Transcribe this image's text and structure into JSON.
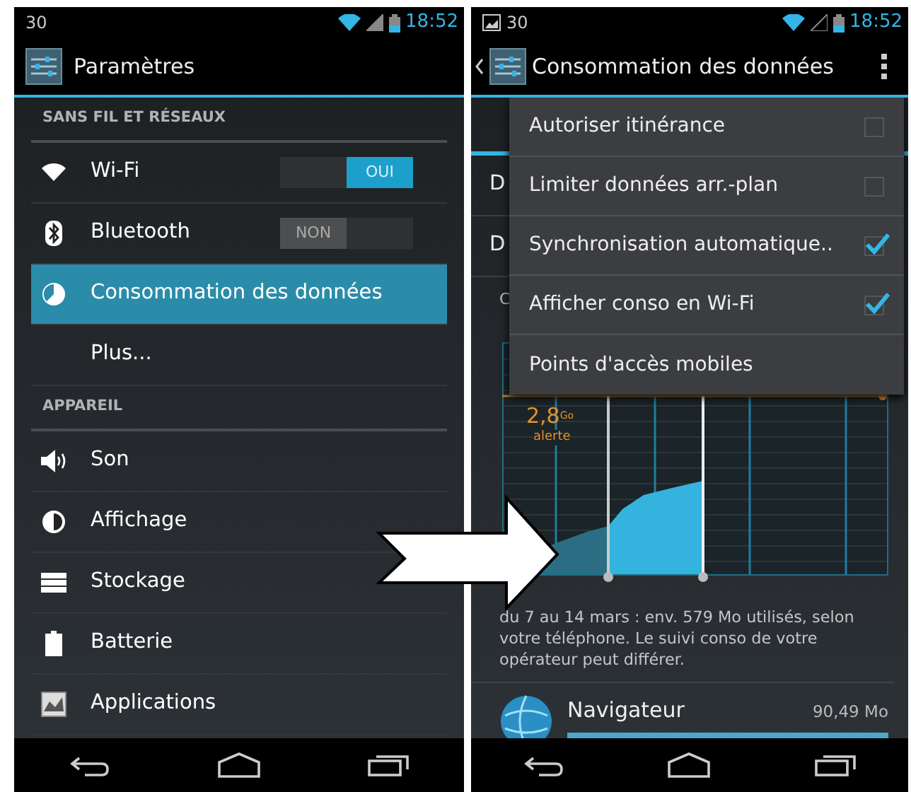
{
  "left_phone": {
    "status_bar": {
      "notification": "30",
      "time": "18:52"
    },
    "title": "Paramètres",
    "sections": [
      {
        "header": "SANS FIL ET RÉSEAUX",
        "items": [
          {
            "label": "Wi-Fi",
            "selected": false,
            "toggle": {
              "label": "OUI",
              "on": true
            }
          },
          {
            "label": "Bluetooth",
            "selected": false,
            "toggle": {
              "label": "NON",
              "on": false
            }
          },
          {
            "label": "Consommation des données",
            "selected": true
          },
          {
            "label": "Plus...",
            "selected": false
          }
        ]
      },
      {
        "header": "APPAREIL",
        "items": [
          {
            "label": "Son",
            "selected": false
          },
          {
            "label": "Affichage",
            "selected": false
          },
          {
            "label": "Stockage",
            "selected": false
          },
          {
            "label": "Batterie",
            "selected": false
          },
          {
            "label": "Applications",
            "selected": false
          }
        ]
      }
    ]
  },
  "right_phone": {
    "status_bar": {
      "notification": "30",
      "time": "18:52"
    },
    "title": "Consommation des données",
    "hidden_rows": [
      "D",
      "D"
    ],
    "hidden_header": "C",
    "menu": [
      {
        "kind": "checkbox",
        "label": "Autoriser itinérance",
        "checked": false
      },
      {
        "kind": "checkbox",
        "label": "Limiter données arr.-plan",
        "checked": false
      },
      {
        "kind": "checkbox",
        "label": "Synchronisation automatique..",
        "checked": true
      },
      {
        "kind": "checkbox",
        "label": "Afficher conso en Wi-Fi",
        "checked": true
      },
      {
        "kind": "action",
        "label": "Points d'accès mobiles"
      }
    ],
    "chart": {
      "limit_value": "2,8$^{Go}$",
      "limit_label": "alerte"
    },
    "summary": "du 7 au 14 mars : env. 579 Mo utilisés, selon votre téléphone. Le suivi conso de votre opérateur peut différer.",
    "apps": [
      {
        "name": "Navigateur",
        "usage": "90,49 Mo",
        "level": 1
      }
    ]
  }
}
